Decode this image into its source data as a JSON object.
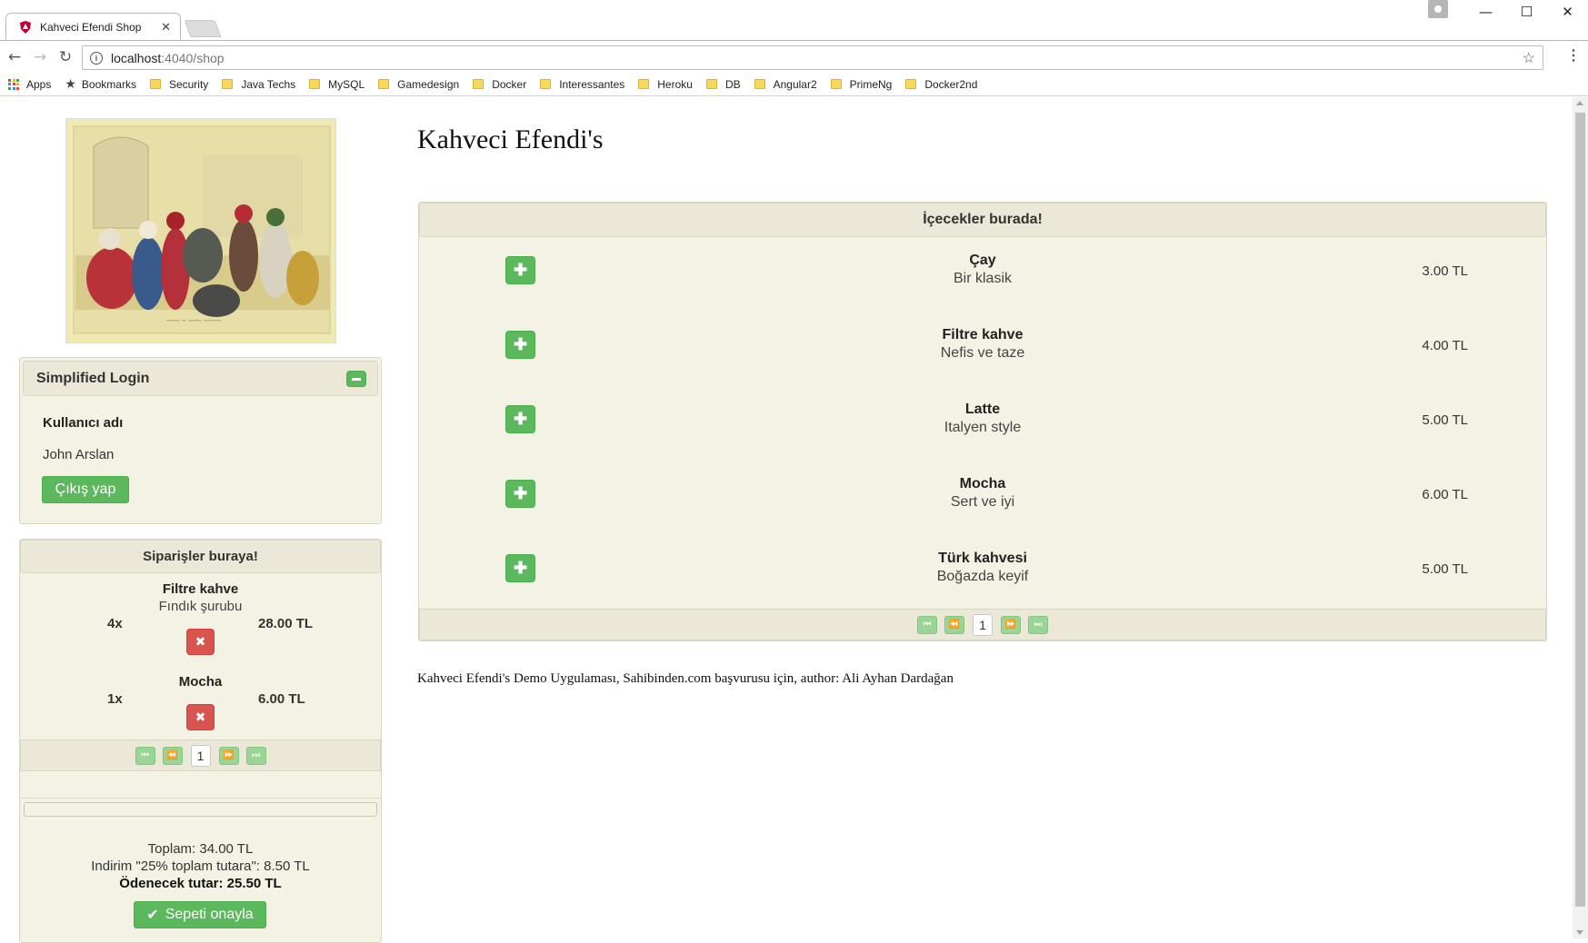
{
  "browser": {
    "tab_title": "Kahveci Efendi Shop",
    "tab_close": "✕",
    "url_host": "localhost",
    "url_path": ":4040/shop",
    "bookmarks": [
      {
        "label": "Apps",
        "icon": "apps-grid-icon"
      },
      {
        "label": "Bookmarks",
        "icon": "star-icon"
      },
      {
        "label": "Security",
        "icon": "folder-icon"
      },
      {
        "label": "Java Techs",
        "icon": "folder-icon"
      },
      {
        "label": "MySQL",
        "icon": "folder-icon"
      },
      {
        "label": "Gamedesign",
        "icon": "folder-icon"
      },
      {
        "label": "Docker",
        "icon": "folder-icon"
      },
      {
        "label": "Interessantes",
        "icon": "folder-icon"
      },
      {
        "label": "Heroku",
        "icon": "folder-icon"
      },
      {
        "label": "DB",
        "icon": "folder-icon"
      },
      {
        "label": "Angular2",
        "icon": "folder-icon"
      },
      {
        "label": "PrimeNg",
        "icon": "folder-icon"
      },
      {
        "label": "Docker2nd",
        "icon": "folder-icon"
      }
    ]
  },
  "login": {
    "header": "Simplified Login",
    "username_label": "Kullanıcı adı",
    "username_value": "John Arslan",
    "logout_label": "Çıkış yap"
  },
  "orders": {
    "header": "Siparişler buraya!",
    "items": [
      {
        "name": "Filtre kahve",
        "desc": "Fındık şurubu",
        "qty": "4x",
        "price": "28.00 TL"
      },
      {
        "name": "Mocha",
        "desc": "",
        "qty": "1x",
        "price": "6.00 TL"
      }
    ],
    "page": "1"
  },
  "summary": {
    "total": "Toplam: 34.00 TL",
    "discount": "Indirim \"25% toplam tutara\": 8.50 TL",
    "payable": "Ödenecek tutar: 25.50 TL",
    "confirm_label": "Sepeti onayla"
  },
  "shop": {
    "title": "Kahveci Efendi's",
    "header": "İçecekler burada!",
    "products": [
      {
        "name": "Çay",
        "desc": "Bir klasik",
        "price": "3.00 TL"
      },
      {
        "name": "Filtre kahve",
        "desc": "Nefis ve taze",
        "price": "4.00 TL"
      },
      {
        "name": "Latte",
        "desc": "Italyen style",
        "price": "5.00 TL"
      },
      {
        "name": "Mocha",
        "desc": "Sert ve iyi",
        "price": "6.00 TL"
      },
      {
        "name": "Türk kahvesi",
        "desc": "Boğazda keyif",
        "price": "5.00 TL"
      }
    ],
    "page": "1"
  },
  "footer": "Kahveci Efendi's Demo Uygulaması, Sahibinden.com başvurusu için, author: Ali Ayhan Dardağan",
  "colors": {
    "accent_green": "#5cb85c",
    "danger_red": "#d9534f",
    "panel_bg": "#f4f2e5",
    "panel_header_bg": "#ebe8d8"
  }
}
